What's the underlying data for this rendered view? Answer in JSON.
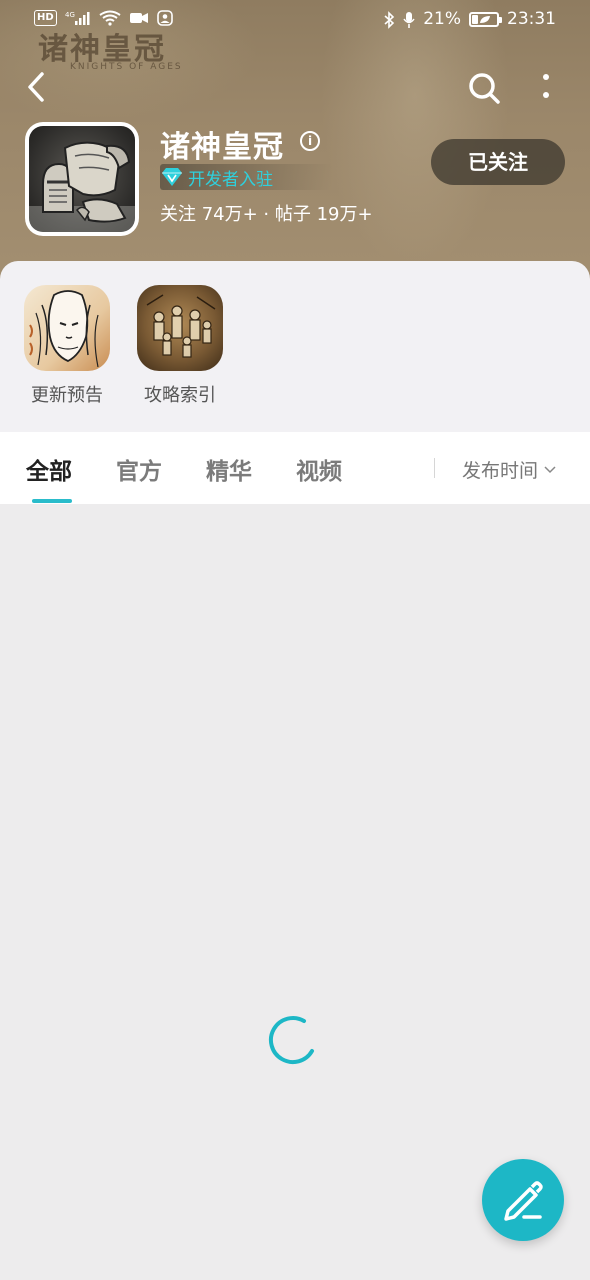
{
  "status_bar": {
    "battery_percent": "21%",
    "time": "23:31",
    "network": "4G",
    "hd_label": "HD"
  },
  "header": {
    "watermark_title": "诸神皇冠",
    "watermark_sub": "KNIGHTS OF AGES"
  },
  "game": {
    "title": "诸神皇冠",
    "developer_badge": "开发者入驻",
    "stats": "关注 74万+ · 帖子 19万+",
    "follow_label": "已关注"
  },
  "quick_links": [
    {
      "label": "更新预告",
      "icon": "elf-portrait-icon"
    },
    {
      "label": "攻略索引",
      "icon": "battle-scene-icon"
    }
  ],
  "tabs": [
    {
      "label": "全部",
      "active": true
    },
    {
      "label": "官方",
      "active": false
    },
    {
      "label": "精华",
      "active": false
    },
    {
      "label": "视频",
      "active": false
    }
  ],
  "sort": {
    "label": "发布时间"
  },
  "colors": {
    "accent": "#1db7c6",
    "header_bg": "#9b876a",
    "badge_text": "#2fd0dc"
  },
  "icons": {
    "back": "back-arrow-icon",
    "search": "search-icon",
    "more": "more-vertical-icon",
    "fab": "edit-pen-icon",
    "loading": "loading-spinner-icon"
  }
}
